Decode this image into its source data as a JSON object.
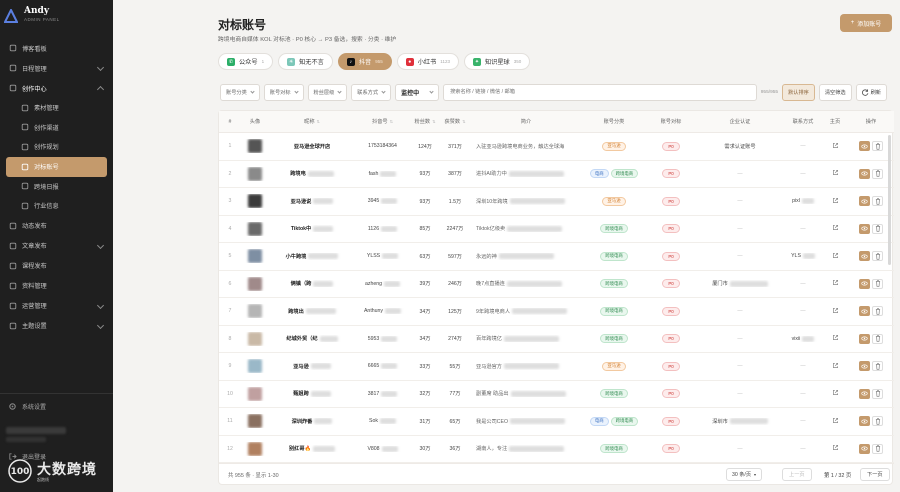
{
  "brand": {
    "name": "Andy",
    "sub": "ADMIN PANEL"
  },
  "sidebar": {
    "items": [
      {
        "label": "博客看板",
        "icon": "dashboard-icon",
        "type": "top"
      },
      {
        "label": "日程管理",
        "icon": "calendar-icon",
        "type": "top",
        "chevron": "down"
      },
      {
        "label": "创作中心",
        "icon": "edit-icon",
        "type": "open",
        "chevron": "up"
      },
      {
        "label": "素材管理",
        "icon": "folder-icon",
        "type": "sub"
      },
      {
        "label": "创作渠道",
        "icon": "share-icon",
        "type": "sub"
      },
      {
        "label": "创作规划",
        "icon": "doc-icon",
        "type": "sub"
      },
      {
        "label": "对标账号",
        "icon": "target-icon",
        "type": "active"
      },
      {
        "label": "跨境日报",
        "icon": "news-icon",
        "type": "sub"
      },
      {
        "label": "行业信息",
        "icon": "grid-icon",
        "type": "sub"
      },
      {
        "label": "动态发布",
        "icon": "send-icon",
        "type": "top"
      },
      {
        "label": "文章发布",
        "icon": "article-icon",
        "type": "top",
        "chevron": "down"
      },
      {
        "label": "课程发布",
        "icon": "course-icon",
        "type": "top"
      },
      {
        "label": "资料管理",
        "icon": "file-icon",
        "type": "top"
      },
      {
        "label": "运营管理",
        "icon": "chart-icon",
        "type": "top",
        "chevron": "down"
      },
      {
        "label": "主题设置",
        "icon": "theme-icon",
        "type": "top",
        "chevron": "down"
      }
    ],
    "settings_label": "系统设置",
    "logout_label": "退出登录"
  },
  "watermark": {
    "logo_text": "100",
    "text": "大数跨境",
    "sub": "起跑线"
  },
  "header": {
    "title": "对标账号",
    "subtitle": "跨境电商自媒体 KOL 对标池 · P0 核心 → P3 备选，搜索 · 分类 · 维护",
    "add_label": "添加账号"
  },
  "platform_tabs": [
    {
      "label": "公众号",
      "count": "1",
      "color": "#2aae67",
      "glyph": "✆",
      "active": false
    },
    {
      "label": "知无不言",
      "count": "",
      "color": "#7cc7b8",
      "glyph": "✳",
      "active": false
    },
    {
      "label": "抖音",
      "count": "955",
      "color": "#111111",
      "glyph": "♪",
      "active": true
    },
    {
      "label": "小红书",
      "count": "1123",
      "color": "#e0303a",
      "glyph": "●",
      "active": false
    },
    {
      "label": "知识星球",
      "count": "350",
      "color": "#39b36a",
      "glyph": "✦",
      "active": false
    }
  ],
  "filters": {
    "selects": [
      "账号分类",
      "账号对标",
      "粉丝层级",
      "联系方式"
    ],
    "status": "监控中",
    "search_placeholder": "搜索名称 / 链接 / 微信 / 邮箱",
    "count": "955/955",
    "sort_label": "默认排序",
    "clear_label": "清空筛选",
    "refresh_label": "刷新"
  },
  "table": {
    "headers": [
      "#",
      "头像",
      "昵称",
      "抖音号",
      "粉丝数",
      "获赞数",
      "简介",
      "账号分类",
      "账号对标",
      "企业认证",
      "联系方式",
      "主页",
      "操作"
    ],
    "rows": [
      {
        "idx": "1",
        "name": "亚马逊全球开店",
        "blur_name": 0,
        "acct": "1753184364",
        "fans": "124万",
        "likes": "371万",
        "intro": "入驻亚马逊跨境电商业务，触达全球海",
        "tags": [
          {
            "t": "亚马逊",
            "c": "orange"
          }
        ],
        "p": "P0",
        "cert": "需求认证账号",
        "contact": "—",
        "avatar": "#555555"
      },
      {
        "idx": "2",
        "name": "跨境电",
        "blur_name": 26,
        "acct": "fash",
        "fans": "93万",
        "likes": "387万",
        "intro": "进抖AI助力中",
        "tags": [
          {
            "t": "电商",
            "c": "blue"
          },
          {
            "t": "跨境电商",
            "c": "green"
          }
        ],
        "p": "P0",
        "cert": "—",
        "contact": "—",
        "avatar": "#8a8a8a"
      },
      {
        "idx": "3",
        "name": "亚马逊说",
        "blur_name": 20,
        "acct": "3945",
        "fans": "93万",
        "likes": "1.5万",
        "intro": "深圳10年跨境",
        "tags": [
          {
            "t": "亚马逊",
            "c": "orange"
          }
        ],
        "p": "P0",
        "cert": "—",
        "contact": "pixl",
        "avatar": "#3b3b3b"
      },
      {
        "idx": "4",
        "name": "Tiktok中",
        "blur_name": 20,
        "acct": "1126",
        "fans": "85万",
        "likes": "2247万",
        "intro": "Tiktok亿级卖",
        "tags": [
          {
            "t": "跨境电商",
            "c": "green"
          }
        ],
        "p": "P0",
        "cert": "—",
        "contact": "—",
        "avatar": "#6a6a6a"
      },
      {
        "idx": "5",
        "name": "小牛跨境",
        "blur_name": 30,
        "acct": "YLSS",
        "fans": "63万",
        "likes": "597万",
        "intro": "永远的神",
        "tags": [
          {
            "t": "跨境电商",
            "c": "green"
          }
        ],
        "p": "P0",
        "cert": "—",
        "contact": "YLS",
        "avatar": "#7e8fa3"
      },
      {
        "idx": "6",
        "name": "俩镇（跨",
        "blur_name": 20,
        "acct": "azheng",
        "fans": "39万",
        "likes": "246万",
        "intro": "晚7点直播连",
        "tags": [
          {
            "t": "跨境电商",
            "c": "green"
          }
        ],
        "p": "P0",
        "cert": "厦门市",
        "contact": "—",
        "avatar": "#a08a8a"
      },
      {
        "idx": "7",
        "name": "跨境出",
        "blur_name": 30,
        "acct": "Anthuny",
        "fans": "34万",
        "likes": "125万",
        "intro": "9年跨境电商人",
        "tags": [
          {
            "t": "跨境电商",
            "c": "green"
          }
        ],
        "p": "P0",
        "cert": "—",
        "contact": "—",
        "avatar": "#b5b5b5"
      },
      {
        "idx": "8",
        "name": "纪城外贸（纪",
        "blur_name": 18,
        "acct": "5953",
        "fans": "34万",
        "likes": "274万",
        "intro": "百年跨境亿",
        "tags": [
          {
            "t": "跨境电商",
            "c": "green"
          }
        ],
        "p": "P0",
        "cert": "—",
        "contact": "vixii",
        "avatar": "#c9b9a6"
      },
      {
        "idx": "9",
        "name": "亚马逊",
        "blur_name": 20,
        "acct": "6665",
        "fans": "33万",
        "likes": "55万",
        "intro": "亚马逊官方",
        "tags": [
          {
            "t": "亚马逊",
            "c": "orange"
          }
        ],
        "p": "P0",
        "cert": "—",
        "contact": "—",
        "avatar": "#9ab8c8"
      },
      {
        "idx": "10",
        "name": "甄姐跨",
        "blur_name": 20,
        "acct": "3817",
        "fans": "32万",
        "likes": "77万",
        "intro": "副董席 助品出",
        "tags": [
          {
            "t": "跨境电商",
            "c": "green"
          }
        ],
        "p": "P0",
        "cert": "—",
        "contact": "—",
        "avatar": "#c0a0a0"
      },
      {
        "idx": "11",
        "name": "深圳炸番",
        "blur_name": 18,
        "acct": "Sok",
        "fans": "31万",
        "likes": "65万",
        "intro": "我是公司CEO",
        "tags": [
          {
            "t": "电商",
            "c": "blue"
          },
          {
            "t": "跨境电商",
            "c": "green"
          }
        ],
        "p": "P0",
        "cert": "深圳市",
        "contact": "—",
        "avatar": "#8a7060"
      },
      {
        "idx": "12",
        "name": "别红哥🔥",
        "blur_name": 22,
        "acct": "V808",
        "fans": "30万",
        "likes": "36万",
        "intro": "湖南人，专注",
        "tags": [
          {
            "t": "跨境电商",
            "c": "green"
          }
        ],
        "p": "P0",
        "cert": "—",
        "contact": "—",
        "avatar": "#b08060"
      }
    ]
  },
  "footer": {
    "info": "共 955 条 · 显示 1-30",
    "page_size": "30 条/页",
    "prev": "上一页",
    "page_info": "第 1 / 32 页",
    "next": "下一页"
  }
}
